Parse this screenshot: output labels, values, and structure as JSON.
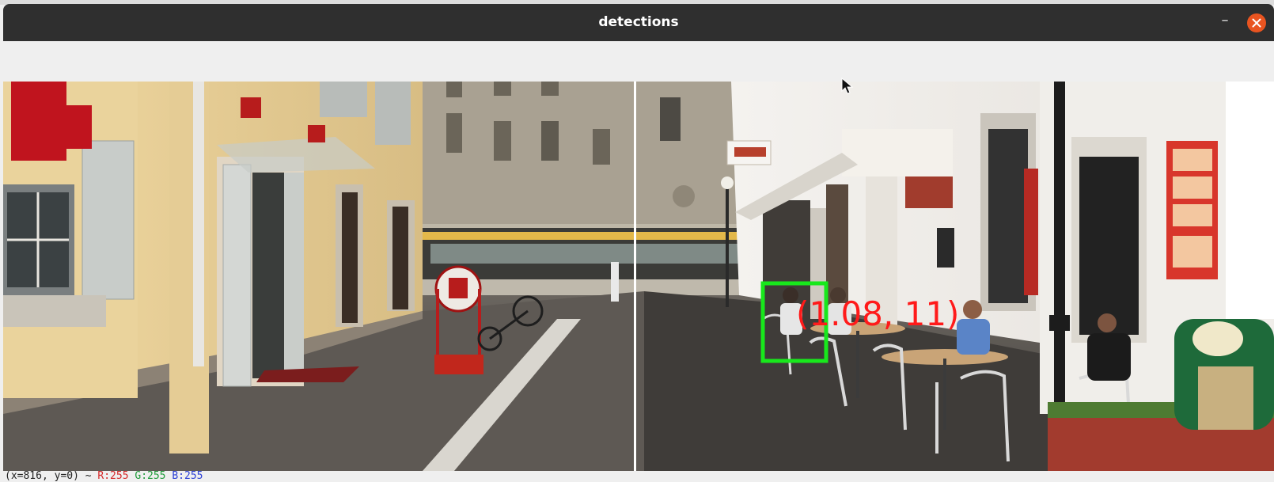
{
  "window": {
    "title": "detections",
    "minimize_symbol": "–",
    "close_icon": "close-icon"
  },
  "detection": {
    "label": "(1.08, 11)",
    "box_color": "#18e81c",
    "label_color": "#ff1a1a"
  },
  "status": {
    "coords": "(x=816, y=0) ~",
    "r_label": "R:255",
    "g_label": "G:255",
    "b_label": "B:255"
  },
  "colors": {
    "titlebar": "#2f2f2f",
    "close_button": "#e95420",
    "divider": "#ffffff"
  }
}
